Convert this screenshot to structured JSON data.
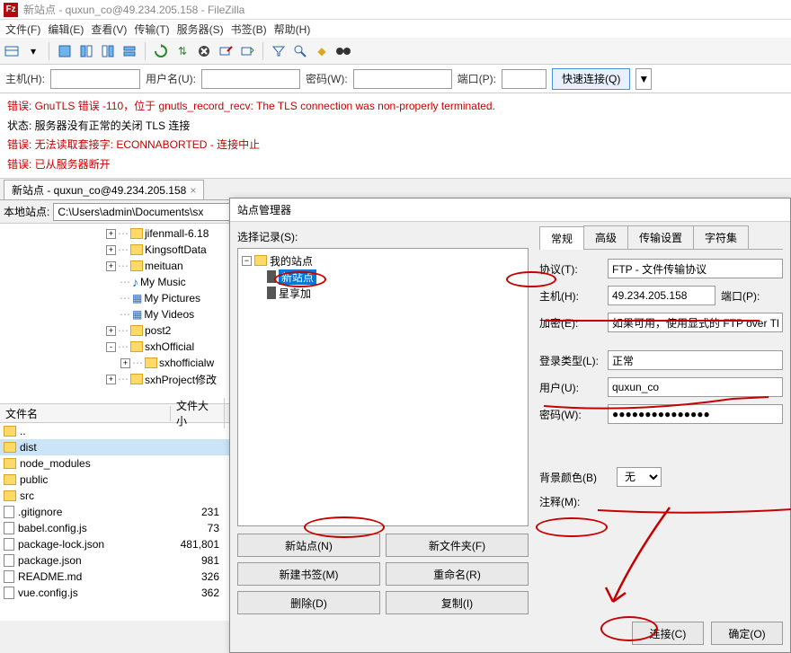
{
  "title": "新站点 - quxun_co@49.234.205.158 - FileZilla",
  "app_icon": "Fz",
  "menu": [
    "文件(F)",
    "编辑(E)",
    "查看(V)",
    "传输(T)",
    "服务器(S)",
    "书签(B)",
    "帮助(H)"
  ],
  "toolbar_icons": [
    "site-manager",
    "toggle-log",
    "toggle-local",
    "toggle-remote",
    "toggle-queue",
    "sync",
    "refresh",
    "tree-filter",
    "cancel",
    "disconnect",
    "reconnect",
    "filter-compare",
    "find",
    "server-process",
    "binoculars"
  ],
  "quickconnect": {
    "host_label": "主机(H):",
    "host_value": "",
    "user_label": "用户名(U):",
    "user_value": "",
    "pass_label": "密码(W):",
    "pass_value": "",
    "port_label": "端口(P):",
    "port_value": "",
    "button": "快速连接(Q)"
  },
  "log": [
    {
      "type": "err",
      "label": "错误:",
      "msg": "GnuTLS 错误 -110，位于 gnutls_record_recv: The TLS connection was non-properly terminated."
    },
    {
      "type": "status",
      "label": "状态:",
      "msg": "服务器没有正常的关闭 TLS 连接"
    },
    {
      "type": "err",
      "label": "错误:",
      "msg": "无法读取套接字: ECONNABORTED - 连接中止"
    },
    {
      "type": "err",
      "label": "错误:",
      "msg": "已从服务器断开"
    }
  ],
  "conn_tab": "新站点 - quxun_co@49.234.205.158",
  "local_label": "本地站点:",
  "local_path": "C:\\Users\\admin\\Documents\\sx",
  "tree": [
    {
      "indent": 1,
      "exp": "+",
      "icon": "folder",
      "name": "jifenmall-6.18"
    },
    {
      "indent": 1,
      "exp": "+",
      "icon": "folder",
      "name": "KingsoftData"
    },
    {
      "indent": 1,
      "exp": "+",
      "icon": "folder",
      "name": "meituan"
    },
    {
      "indent": 1,
      "exp": "",
      "icon": "music",
      "name": "My Music"
    },
    {
      "indent": 1,
      "exp": "",
      "icon": "pic",
      "name": "My Pictures"
    },
    {
      "indent": 1,
      "exp": "",
      "icon": "pic",
      "name": "My Videos"
    },
    {
      "indent": 1,
      "exp": "+",
      "icon": "folder",
      "name": "post2"
    },
    {
      "indent": 1,
      "exp": "-",
      "icon": "folder",
      "name": "sxhOfficial"
    },
    {
      "indent": 2,
      "exp": "+",
      "icon": "folder",
      "name": "sxhofficialw"
    },
    {
      "indent": 1,
      "exp": "+",
      "icon": "folder",
      "name": "sxhProject修改"
    }
  ],
  "filelist_headers": {
    "name": "文件名",
    "size": "文件大小"
  },
  "files": [
    {
      "name": "..",
      "size": "",
      "icon": "folder",
      "sel": false
    },
    {
      "name": "dist",
      "size": "",
      "icon": "folder",
      "sel": true
    },
    {
      "name": "node_modules",
      "size": "",
      "icon": "folder",
      "sel": false
    },
    {
      "name": "public",
      "size": "",
      "icon": "folder",
      "sel": false
    },
    {
      "name": "src",
      "size": "",
      "icon": "folder",
      "sel": false
    },
    {
      "name": ".gitignore",
      "size": "231",
      "icon": "file",
      "sel": false
    },
    {
      "name": "babel.config.js",
      "size": "73",
      "icon": "file",
      "sel": false
    },
    {
      "name": "package-lock.json",
      "size": "481,801",
      "icon": "file",
      "sel": false
    },
    {
      "name": "package.json",
      "size": "981",
      "icon": "file",
      "sel": false
    },
    {
      "name": "README.md",
      "size": "326",
      "icon": "file",
      "sel": false
    },
    {
      "name": "vue.config.js",
      "size": "362",
      "icon": "file",
      "sel": false
    }
  ],
  "dialog": {
    "title": "站点管理器",
    "select_label": "选择记录(S):",
    "root": "我的站点",
    "sites": [
      {
        "name": "新站点",
        "selected": true
      },
      {
        "name": "星享加",
        "selected": false
      }
    ],
    "buttons": {
      "newsite": "新站点(N)",
      "newfolder": "新文件夹(F)",
      "newbookmark": "新建书签(M)",
      "rename": "重命名(R)",
      "delete": "删除(D)",
      "duplicate": "复制(I)"
    },
    "tabs": [
      "常规",
      "高级",
      "传输设置",
      "字符集"
    ],
    "form": {
      "protocol_label": "协议(T):",
      "protocol_value": "FTP - 文件传输协议",
      "host_label": "主机(H):",
      "host_value": "49.234.205.158",
      "port_label": "端口(P):",
      "port_value": "",
      "encryption_label": "加密(E):",
      "encryption_value": "如果可用，使用显式的 FTP over TL",
      "logon_label": "登录类型(L):",
      "logon_value": "正常",
      "user_label": "用户(U):",
      "user_value": "quxun_co",
      "pass_label": "密码(W):",
      "pass_value": "●●●●●●●●●●●●●●●",
      "bgcolor_label": "背景颜色(B)",
      "bgcolor_value": "无",
      "comment_label": "注释(M):"
    },
    "footer": {
      "connect": "连接(C)",
      "ok": "确定(O)"
    }
  }
}
